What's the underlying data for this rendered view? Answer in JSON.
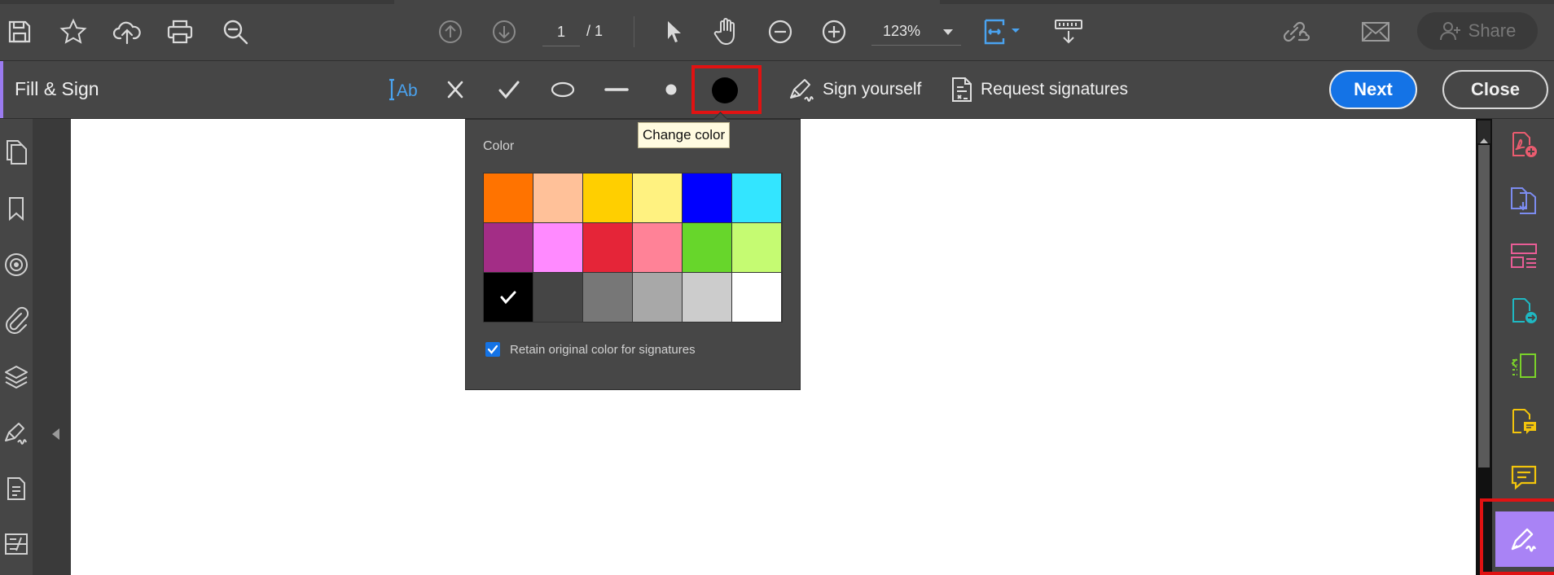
{
  "toolbar": {
    "page_current": "1",
    "page_total": "/ 1",
    "zoom": "123%",
    "share_label": "Share",
    "icons": [
      "save-icon",
      "bookmark-star-icon",
      "upload-cloud-icon",
      "print-icon",
      "search-zoom-icon",
      "page-up-icon",
      "page-down-icon",
      "select-cursor-icon",
      "hand-tool-icon",
      "zoom-out-icon",
      "zoom-in-icon",
      "fit-page-icon",
      "scroll-mode-icon",
      "link-icon",
      "mail-icon"
    ]
  },
  "fill_sign": {
    "title": "Fill & Sign",
    "sign_yourself": "Sign yourself",
    "request_signatures": "Request signatures",
    "next": "Next",
    "close": "Close",
    "tooltip": "Change color"
  },
  "color_popup": {
    "title": "Color",
    "swatches": [
      "#ff7300",
      "#ffc199",
      "#ffcf00",
      "#fff280",
      "#0000ff",
      "#33e5ff",
      "#a32d86",
      "#ff8aff",
      "#e52538",
      "#ff8297",
      "#67d62b",
      "#c5fb72",
      "#000000",
      "#454545",
      "#777777",
      "#a8a8a8",
      "#cccccc",
      "#ffffff"
    ],
    "selected_index": 12,
    "retain_label": "Retain original color for signatures",
    "retain_checked": true
  },
  "colors": {
    "accent_blue": "#1473e6",
    "purple_active": "#a983f5",
    "highlight_red": "#e11212"
  }
}
